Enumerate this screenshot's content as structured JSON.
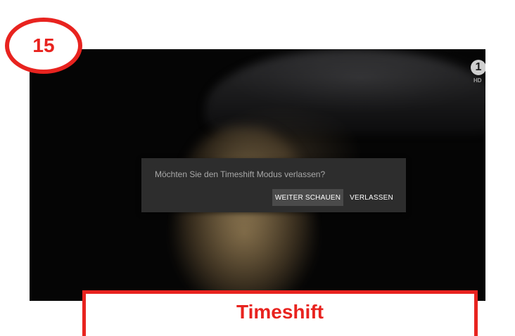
{
  "step": {
    "number": "15"
  },
  "channel": {
    "logo_glyph": "1",
    "badge": "HD",
    "icon": "ard-1-logo-icon"
  },
  "dialog": {
    "message": "Möchten Sie den Timeshift Modus verlassen?",
    "continue_label": "WEITER SCHAUEN",
    "leave_label": "VERLASSEN"
  },
  "caption": {
    "title": "Timeshift"
  },
  "colors": {
    "accent": "#e8231f",
    "dialog_bg": "#2d2d2d",
    "focused_button": "#4a4a4a",
    "message_text": "#a8a8a8"
  }
}
